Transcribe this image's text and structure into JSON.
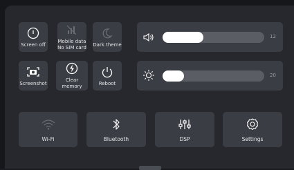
{
  "toggles": [
    {
      "label": "Screen off",
      "icon": "power-circle-icon",
      "active": true
    },
    {
      "label": "Mobile data\nNo SIM card",
      "icon": "mobile-data-icon",
      "active": false
    },
    {
      "label": "Dark theme",
      "icon": "moon-icon",
      "active": false
    },
    {
      "label": "Screenshot",
      "icon": "screenshot-icon",
      "active": true
    },
    {
      "label": "Clear memory",
      "icon": "clear-memory-icon",
      "active": true
    },
    {
      "label": "Reboot",
      "icon": "power-icon",
      "active": true
    }
  ],
  "volume": {
    "value": "12",
    "level": 0.4,
    "icon": "speaker-icon"
  },
  "brightness": {
    "value": "20",
    "level": 0.21,
    "icon": "sun-icon"
  },
  "bottom": [
    {
      "label": "Wi-Fi",
      "icon": "wifi-icon",
      "active": false
    },
    {
      "label": "Bluetooth",
      "icon": "bluetooth-icon",
      "active": true
    },
    {
      "label": "DSP",
      "icon": "equalizer-icon",
      "active": true
    },
    {
      "label": "Settings",
      "icon": "gear-icon",
      "active": true
    }
  ],
  "colors": {
    "background": "#26282d",
    "tile": "#3a3d43",
    "accent": "#ffffff",
    "muted": "#8a8d93"
  }
}
